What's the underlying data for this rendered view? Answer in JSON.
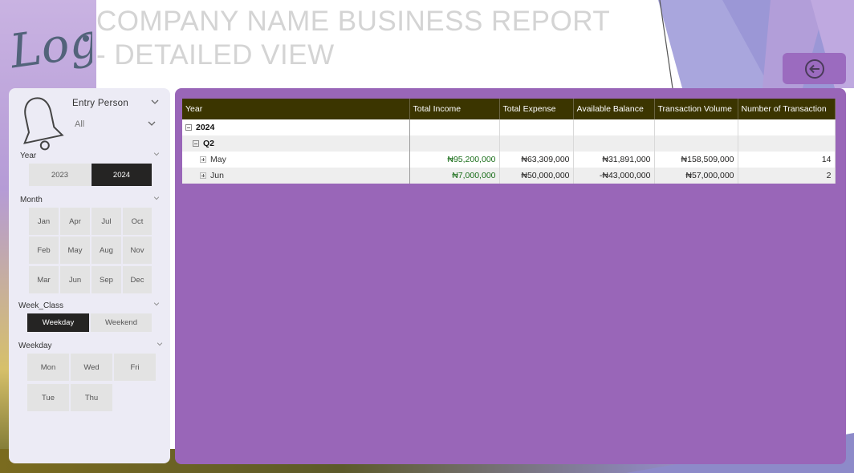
{
  "header": {
    "logo_text": "Logo",
    "title": "COMPANY NAME BUSINESS REPORT - DETAILED VIEW",
    "back_icon": "arrow-left-circle-icon"
  },
  "filters": {
    "entry_person": {
      "label": "Entry Person",
      "value": "All",
      "icon": "bell-icon"
    },
    "year": {
      "label": "Year",
      "options": [
        "2023",
        "2024"
      ],
      "selected": "2024"
    },
    "month": {
      "label": "Month",
      "options": [
        "Jan",
        "Apr",
        "Jul",
        "Oct",
        "Feb",
        "May",
        "Aug",
        "Nov",
        "Mar",
        "Jun",
        "Sep",
        "Dec"
      ]
    },
    "week_class": {
      "label": "Week_Class",
      "options": [
        "Weekday",
        "Weekend"
      ],
      "selected": "Weekday"
    },
    "weekday": {
      "label": "Weekday",
      "options": [
        "Mon",
        "Wed",
        "Fri",
        "Tue",
        "Thu"
      ]
    }
  },
  "matrix": {
    "columns": [
      "Year",
      "Total Income",
      "Total Expense",
      "Available Balance",
      "Transaction Volume",
      "Number of Transaction"
    ],
    "year_row": "2024",
    "quarter_row": "Q2",
    "rows": [
      {
        "label": "May",
        "total_income": "₦95,200,000",
        "total_expense": "₦63,309,000",
        "available_balance": "₦31,891,000",
        "transaction_volume": "₦158,509,000",
        "number_of_transaction": "14"
      },
      {
        "label": "Jun",
        "total_income": "₦7,000,000",
        "total_expense": "₦50,000,000",
        "available_balance": "-₦43,000,000",
        "transaction_volume": "₦57,000,000",
        "number_of_transaction": "2"
      }
    ]
  },
  "colors": {
    "accent_purple": "#9966b8",
    "header_dark": "#3b3500",
    "selected_tile": "#252423",
    "income_green": "#1a6e1a"
  }
}
